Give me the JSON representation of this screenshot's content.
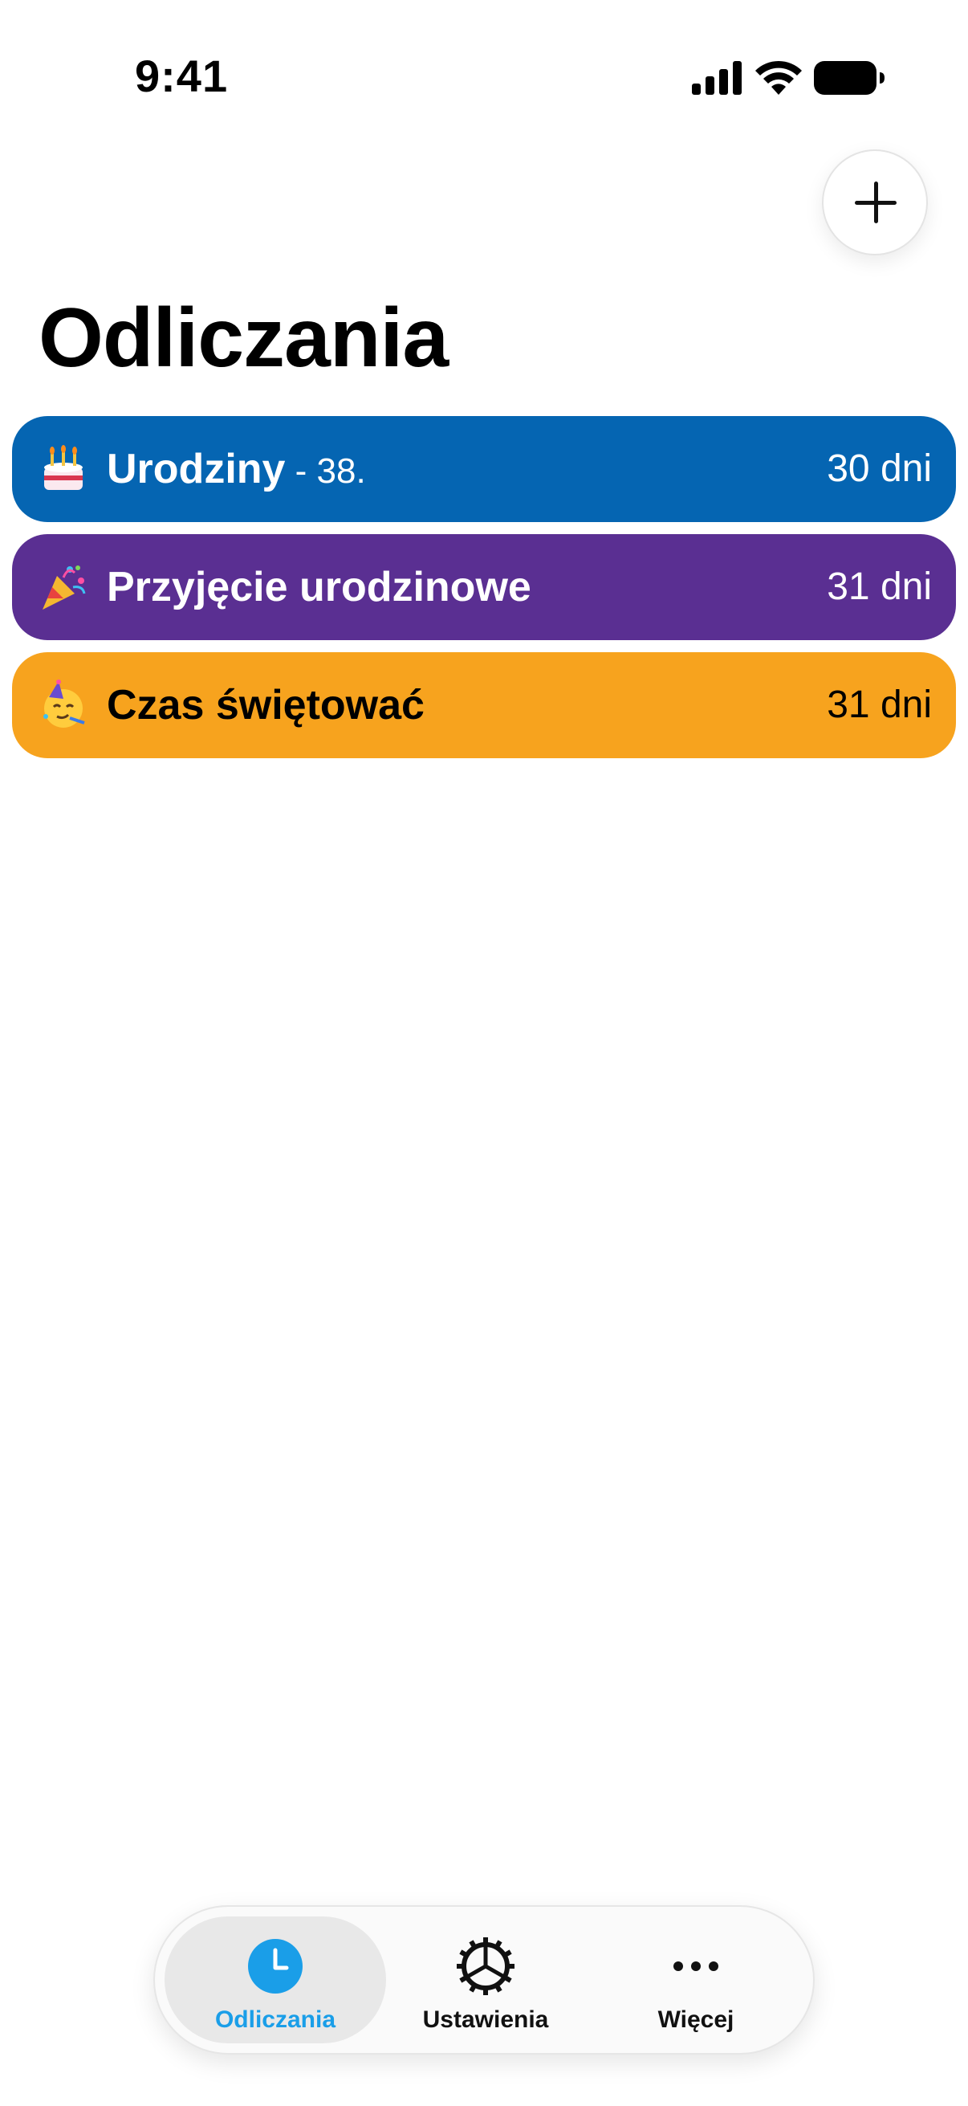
{
  "status_bar": {
    "time": "9:41"
  },
  "header": {
    "title": "Odliczania",
    "add_icon": "plus-icon"
  },
  "countdowns": [
    {
      "emoji": "birthday-cake-icon",
      "name": "Urodziny",
      "age": " - 38.",
      "days": "30 dni",
      "color": "#0565B2",
      "text_color": "#FFFFFF"
    },
    {
      "emoji": "party-popper-icon",
      "name": "Przyjęcie urodzinowe",
      "age": "",
      "days": "31 dni",
      "color": "#5A2F92",
      "text_color": "#FFFFFF"
    },
    {
      "emoji": "partying-face-icon",
      "name": "Czas świętować",
      "age": "",
      "days": "31 dni",
      "color": "#F7A31E",
      "text_color": "#000000"
    }
  ],
  "tab_bar": {
    "tabs": [
      {
        "label": "Odliczania",
        "icon": "clock-icon",
        "active": true
      },
      {
        "label": "Ustawienia",
        "icon": "gear-icon",
        "active": false
      },
      {
        "label": "Więcej",
        "icon": "more-icon",
        "active": false
      }
    ],
    "accent_color": "#1A9EE8"
  }
}
